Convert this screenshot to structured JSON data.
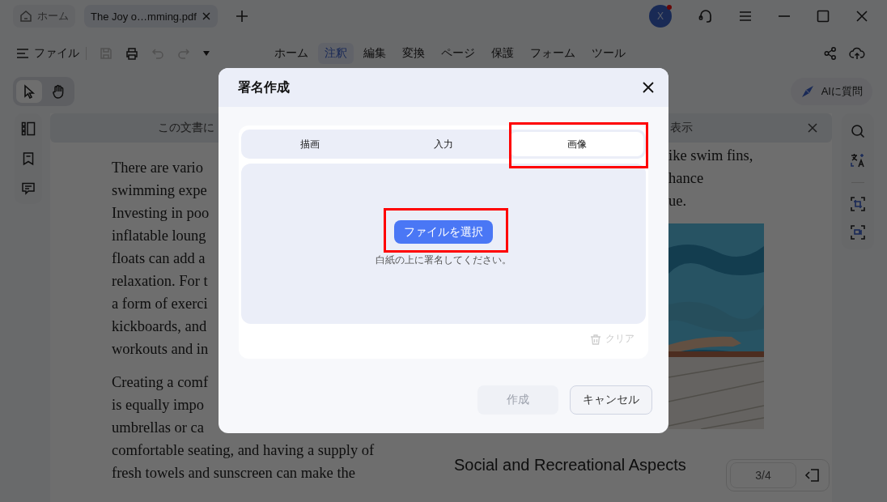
{
  "app_tabs": [
    {
      "kind": "home",
      "label": "ホーム",
      "selected": false
    },
    {
      "kind": "document",
      "label": "The Joy o…mming.pdf",
      "selected": true
    }
  ],
  "account": {
    "initial": "X",
    "notification": true
  },
  "file_menu": "ファイル",
  "actions": [
    {
      "kind": "save",
      "disabled": true
    },
    {
      "kind": "print",
      "disabled": false
    },
    {
      "kind": "undo",
      "disabled": true
    },
    {
      "kind": "redo",
      "disabled": true
    }
  ],
  "menu_tabs": [
    {
      "label": "ホーム",
      "selected": false
    },
    {
      "label": "注釈",
      "selected": true
    },
    {
      "label": "編集",
      "selected": false
    },
    {
      "label": "変換",
      "selected": false
    },
    {
      "label": "ページ",
      "selected": false
    },
    {
      "label": "保護",
      "selected": false
    },
    {
      "label": "フォーム",
      "selected": false
    },
    {
      "label": "ツール",
      "selected": false
    }
  ],
  "tools": [
    {
      "kind": "select",
      "selected": true
    },
    {
      "kind": "hand",
      "selected": false
    }
  ],
  "ai_button": "AIに質問",
  "banner": {
    "text_start": "この文書に",
    "text_end": "表示"
  },
  "document": {
    "left_paragraphs": [
      [
        "There are vario",
        "swimming expe",
        "Investing in poo",
        "inflatable loung",
        "floats can add a",
        "relaxation. For t",
        "a form of exerci",
        "kickboards, and",
        "workouts and in"
      ],
      [
        "Creating a comf",
        "is equally impo",
        "umbrellas or ca",
        "comfortable seating, and having a supply of",
        "fresh towels and sunscreen can make the"
      ]
    ],
    "right_lines": [
      "ike swim fins,",
      "hance",
      "ue."
    ],
    "image": {
      "kind": "picture"
    },
    "heading": "Social and Recreational Aspects"
  },
  "page_nav": {
    "page": "3/4"
  },
  "dialog": {
    "title": "署名作成",
    "tabs": [
      {
        "label": "描画",
        "selected": false
      },
      {
        "label": "入力",
        "selected": false
      },
      {
        "label": "画像",
        "selected": true
      }
    ],
    "choose_file": "ファイルを選択",
    "hint": "白紙の上に署名してください。",
    "clear": {
      "label": "クリア",
      "disabled": true
    },
    "buttons": [
      {
        "kind": "primary",
        "label": "作成",
        "disabled": true
      },
      {
        "kind": "secondary",
        "label": "キャンセル",
        "disabled": false
      }
    ]
  }
}
